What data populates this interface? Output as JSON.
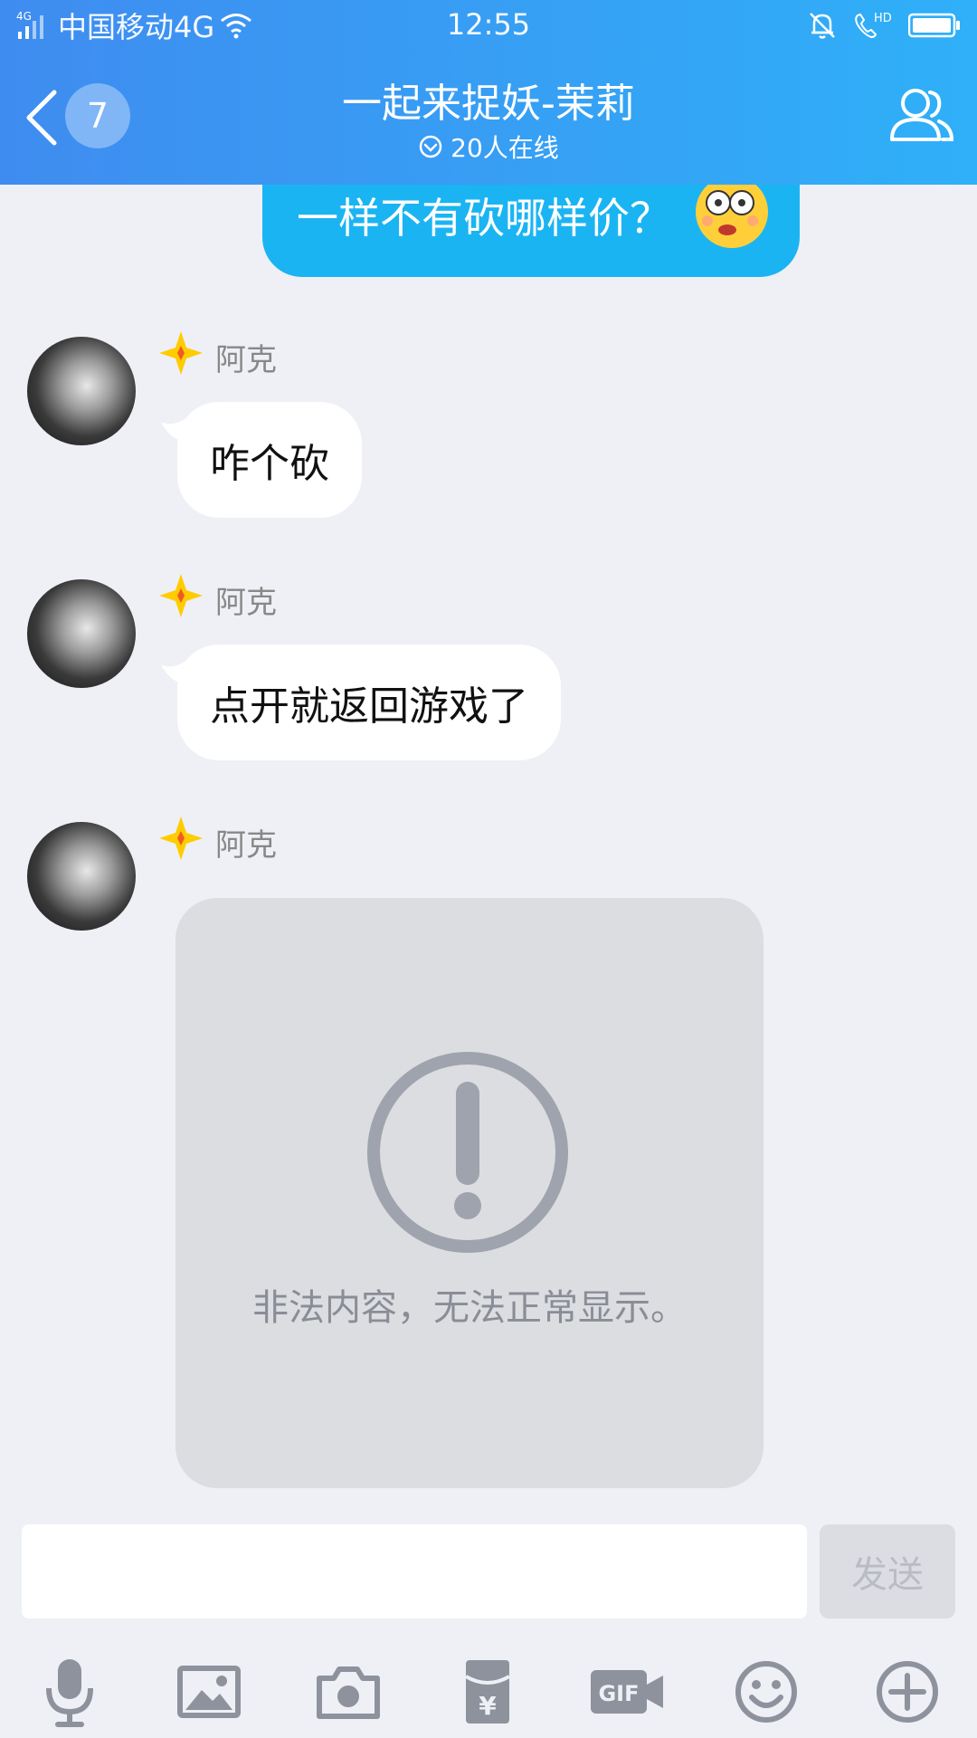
{
  "status_bar": {
    "network_small": "4G",
    "carrier": "中国移动4G",
    "time": "12:55",
    "hd_label": "HD"
  },
  "header": {
    "unread_count": "7",
    "title": "一起来捉妖-茉莉",
    "online": "20人在线"
  },
  "messages": [
    {
      "side": "self",
      "text": "一样不有砍哪样价？",
      "emoji": "dizzy-face"
    },
    {
      "side": "other",
      "sender": "阿克",
      "text": "咋个砍"
    },
    {
      "side": "other",
      "sender": "阿克",
      "text": "点开就返回游戏了"
    },
    {
      "side": "other",
      "sender": "阿克",
      "type": "blocked",
      "notice": "非法内容，无法正常显示。"
    }
  ],
  "input": {
    "value": "",
    "placeholder": "",
    "send_label": "发送"
  },
  "toolbar": {
    "items": [
      "microphone-icon",
      "image-icon",
      "camera-icon",
      "red-packet-icon",
      "gif-icon",
      "emoji-icon",
      "plus-icon"
    ],
    "gif_label": "GIF",
    "yuan_label": "¥"
  },
  "colors": {
    "header_start": "#3f8cf0",
    "header_end": "#2fb0f8",
    "self_bubble": "#1bb4f2",
    "background": "#eef0f6",
    "icon_gray": "#8e929c"
  }
}
